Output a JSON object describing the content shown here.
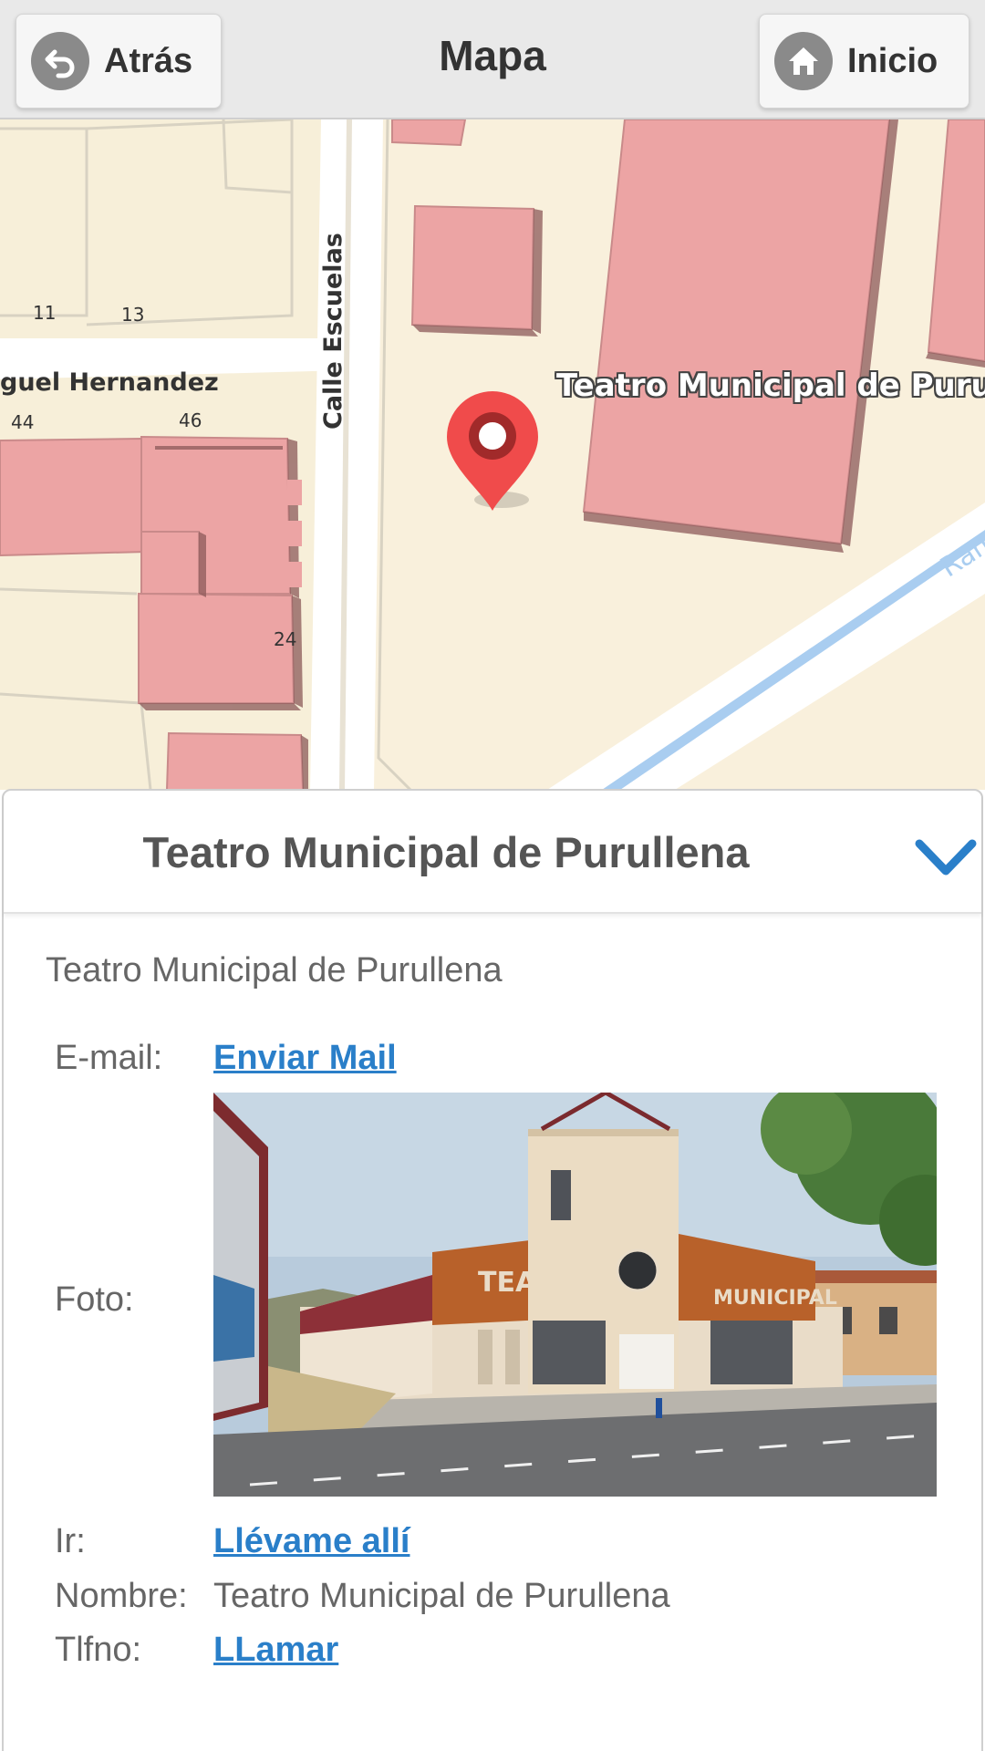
{
  "header": {
    "title": "Mapa",
    "back_label": "Atrás",
    "home_label": "Inicio",
    "back_icon": "back-arrow-icon",
    "home_icon": "house-icon"
  },
  "map": {
    "street_labels": {
      "calle_escuelas": "Calle Escuelas",
      "miguel_hernandez": "guel Hernandez",
      "ram": "Ram"
    },
    "house_numbers": {
      "n11": "11",
      "n13": "13",
      "n44": "44",
      "n46": "46",
      "n24": "24"
    },
    "poi_label": "Teatro Municipal de Purulle",
    "marker_icon": "map-pin-icon",
    "colors": {
      "land": "#f9f0dc",
      "building": "#eca4a4",
      "road": "#ffffff",
      "marker": "#f04b4b",
      "river": "#a9cdf0"
    }
  },
  "panel": {
    "title": "Teatro Municipal de Purullena",
    "collapse_icon": "chevron-down-icon",
    "subtitle": "Teatro Municipal de Purullena",
    "email_label": "E-mail:",
    "email_link": "Enviar Mail",
    "photo_label": "Foto:",
    "photo_sign_1": "TEATRO",
    "photo_sign_2": "MUNICIPAL",
    "go_label": "Ir:",
    "go_link": "Llévame allí",
    "name_label": "Nombre:",
    "name_value": "Teatro Municipal de Purullena",
    "phone_label": "Tlfno:",
    "phone_link": "LLamar",
    "link_color": "#2a7fc9"
  }
}
